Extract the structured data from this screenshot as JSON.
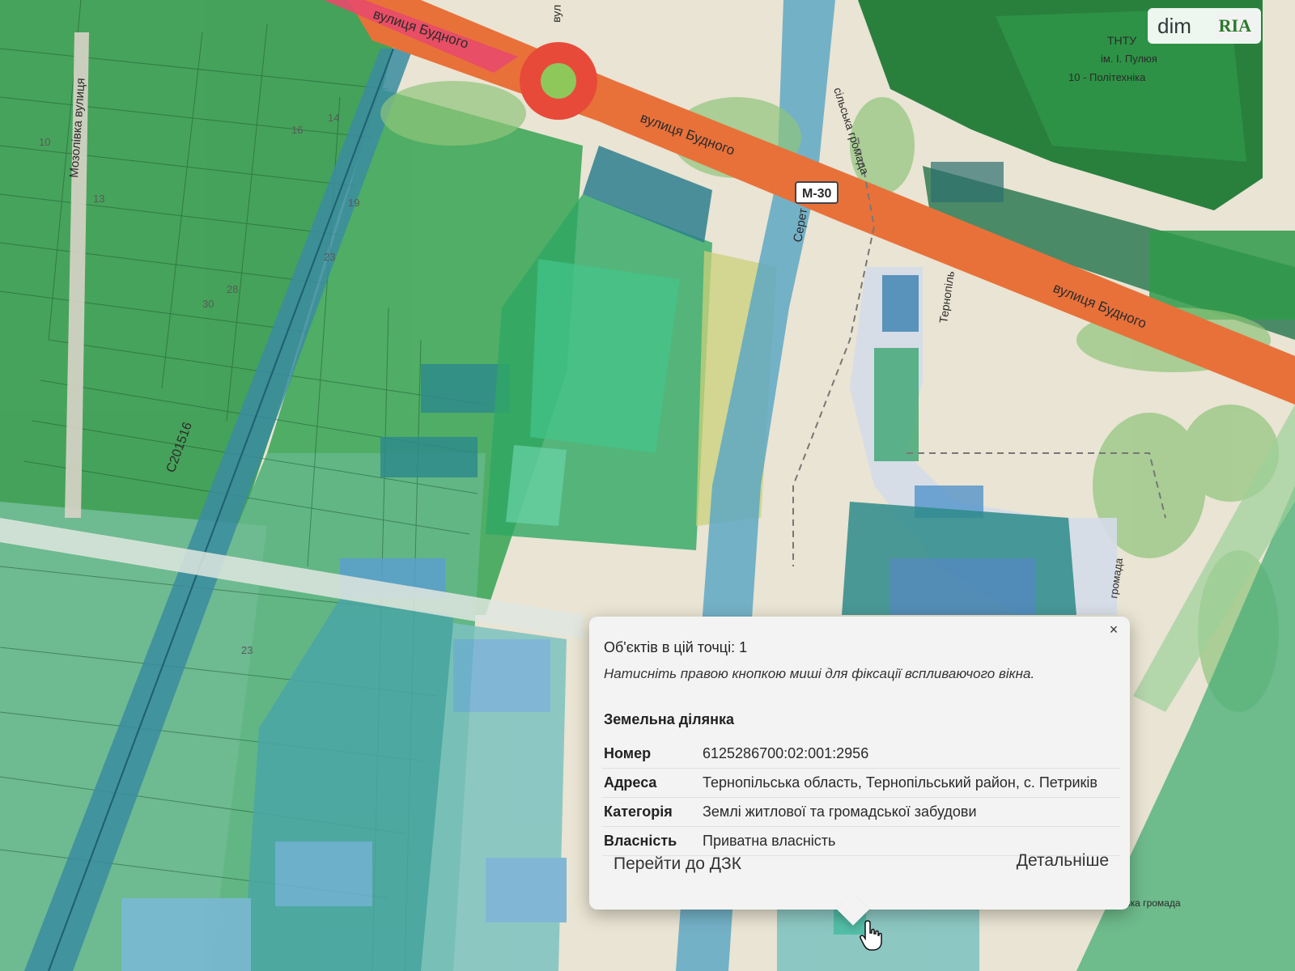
{
  "map": {
    "roads": {
      "street_1": "вулиця Будного",
      "street_2": "вулиця Будного",
      "street_top": "вулиця Будного",
      "side_street_top": "вул",
      "left_street": "Мозолівка вулиця",
      "route_badge": "M-30",
      "route_code": "C201516"
    },
    "river_label": "Серет",
    "village_label": "Тернопіль",
    "community_label": "сільська громада",
    "community_label_2": "громада",
    "community_label_3": "Тернопільська міська громада",
    "poi_label_1": "ТНТУ",
    "poi_label_2": "ім. І. Пулюя",
    "poi_label_3": "10 - Політехніка",
    "house_numbers": [
      "10",
      "16",
      "14",
      "13",
      "19",
      "23",
      "28",
      "30",
      "23"
    ],
    "colors": {
      "parcel_green": "#2f9a4a",
      "parcel_teal": "#2e8b8b",
      "road_orange": "#e8713a",
      "roundabout_red": "#e84a3a",
      "river_blue": "#5ea8c4",
      "base": "#e9e4d3"
    }
  },
  "watermark": {
    "text": "dim",
    "badge": "RIA"
  },
  "popup": {
    "objects_count": "Об'єктів в цій точці: 1",
    "hint": "Натисніть правою кнопкою миші для фіксації вспливаючого вікна.",
    "section_title": "Земельна ділянка",
    "rows": [
      {
        "key": "Номер",
        "value": "6125286700:02:001:2956"
      },
      {
        "key": "Адреса",
        "value": "Тернопільська область, Тернопільський район, с. Петриків"
      },
      {
        "key": "Категорія",
        "value": "Землі житлової та громадської забудови"
      },
      {
        "key": "Власність",
        "value": "Приватна власність"
      }
    ],
    "close_icon": "×",
    "goto_dzk": "Перейти до ДЗК",
    "details": "Детальніше"
  },
  "icons": {
    "cursor": "hand-pointer-icon",
    "close": "close-icon"
  }
}
